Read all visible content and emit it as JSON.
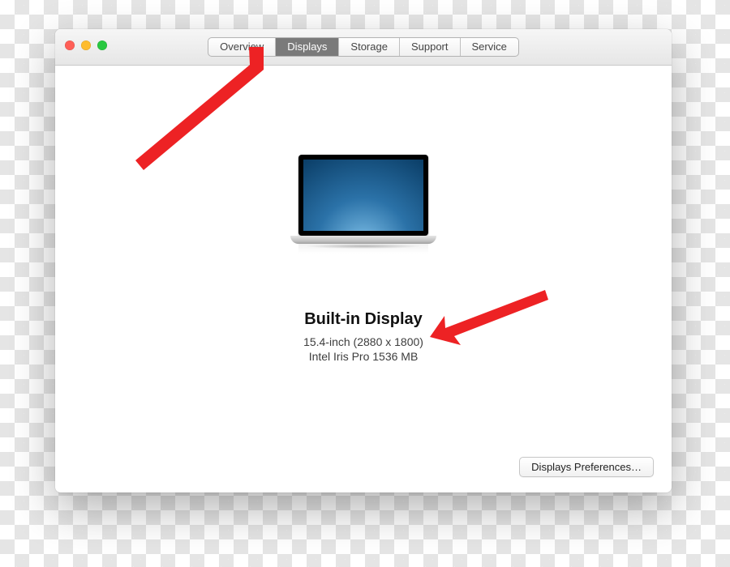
{
  "tabs": {
    "overview": "Overview",
    "displays": "Displays",
    "storage": "Storage",
    "support": "Support",
    "service": "Service",
    "selected": "displays"
  },
  "display": {
    "title": "Built-in Display",
    "resolution": "15.4-inch (2880 x 1800)",
    "gpu": "Intel Iris Pro 1536 MB"
  },
  "buttons": {
    "displays_preferences": "Displays Preferences…"
  },
  "icons": {
    "laptop": "laptop-icon"
  },
  "annotation_arrows": {
    "color": "#ed2224"
  }
}
